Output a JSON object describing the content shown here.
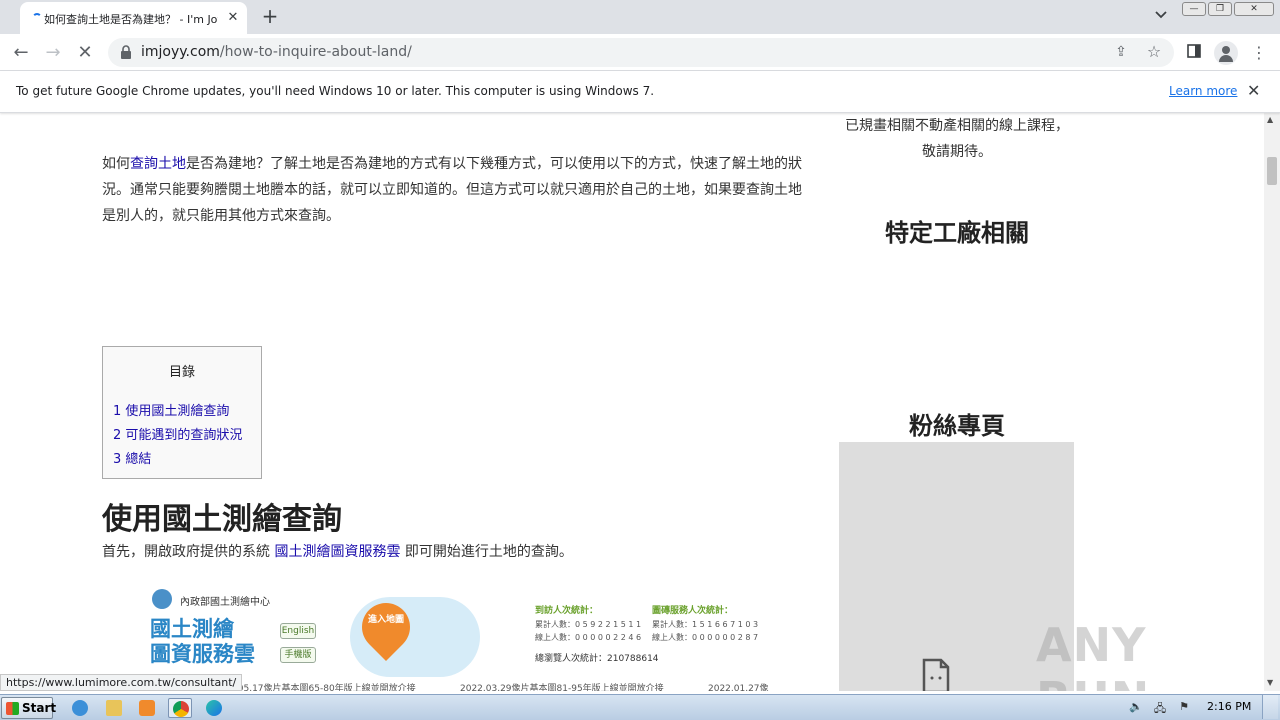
{
  "browser": {
    "tab_title": "如何查詢土地是否為建地？ - I'm Joyy",
    "new_tab": "+",
    "url_host": "imjoyy.com",
    "url_path": "/how-to-inquire-about-land/",
    "tooltip_url": "https://www.lumimore.com.tw/consultant/"
  },
  "infobar": {
    "message": "To get future Google Chrome updates, you'll need Windows 10 or later. This computer is using Windows 7.",
    "link": "Learn more"
  },
  "article": {
    "intro_prefix": "如何",
    "intro_link": "查詢土地",
    "intro_rest": "是否為建地？了解土地是否為建地的方式有以下幾種方式，可以使用以下的方式，快速了解土地的狀況。通常只能要夠謄閱土地謄本的話，就可以立即知道的。但這方式可以就只適用於自己的土地，如果要查詢土地是別人的，就只能用其他方式來查詢。",
    "toc": {
      "title": "目錄",
      "items": [
        "1 使用國土測繪查詢",
        "2 可能遇到的查詢狀況",
        "3 總結"
      ]
    },
    "heading": "使用國土測繪查詢",
    "para2_prefix": "首先，開啟政府提供的系統 ",
    "para2_link": "國土測繪圖資服務雲",
    "para2_suffix": " 即可開始進行土地的查詢。"
  },
  "embedded_image": {
    "agency": "內政部國土測繪中心",
    "service_name_line1": "國土測繪",
    "service_name_line2": "圖資服務雲",
    "english_button": "English",
    "mobile_button": "手機版",
    "enter_map": "進入地圖",
    "visitors_title": "到訪人次統計：",
    "map_service_title": "圖磚服務人次統計：",
    "visitors_row1": "累計人數：0 5 9 2 2 1 5 1 1",
    "visitors_row2": "線上人數：0 0 0 0 0 2 2 4 6",
    "map_row1": "累計人數：1 5 1 6 6 7 1 0 3",
    "map_row2": "線上人數：0 0 0 0 0 0 2 8 7",
    "total": "總瀏覽人次統計：210788614",
    "news": [
      "2022.05.17像片基本圖65-80年版上線並開放介接",
      "2022.03.29像片基本圖81-95年版上線並開放介接",
      "2022.01.27像"
    ]
  },
  "sidebar": {
    "text": "已規畫相關不動產相關的線上課程，敬請期待。",
    "heading1": "特定工廠相關",
    "heading2": "粉絲專頁"
  },
  "watermark": "ANY RUN",
  "taskbar": {
    "start_label": "Start",
    "clock": "2:16 PM"
  }
}
